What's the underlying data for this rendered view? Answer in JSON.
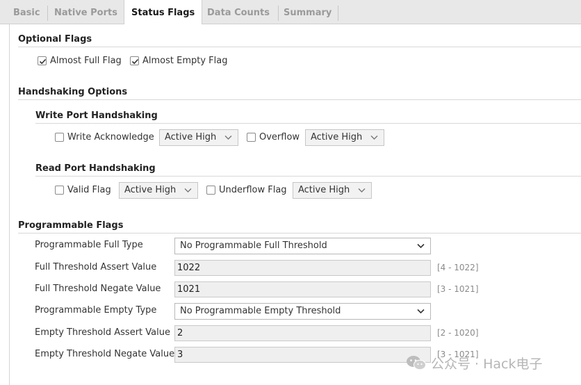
{
  "tabs": [
    {
      "label": "Basic",
      "active": false
    },
    {
      "label": "Native Ports",
      "active": false
    },
    {
      "label": "Status Flags",
      "active": true
    },
    {
      "label": "Data Counts",
      "active": false
    },
    {
      "label": "Summary",
      "active": false
    }
  ],
  "optional_flags": {
    "title": "Optional Flags",
    "almost_full": {
      "label": "Almost Full Flag",
      "checked": true
    },
    "almost_empty": {
      "label": "Almost Empty Flag",
      "checked": true
    }
  },
  "handshaking": {
    "title": "Handshaking Options",
    "write": {
      "title": "Write Port Handshaking",
      "ack_label": "Write Acknowledge",
      "ack_checked": false,
      "ack_select": "Active High",
      "overflow_label": "Overflow",
      "overflow_checked": false,
      "overflow_select": "Active High"
    },
    "read": {
      "title": "Read Port Handshaking",
      "valid_label": "Valid Flag",
      "valid_checked": false,
      "valid_select": "Active High",
      "underflow_label": "Underflow Flag",
      "underflow_checked": false,
      "underflow_select": "Active High"
    }
  },
  "programmable": {
    "title": "Programmable Flags",
    "full_type_label": "Programmable Full Type",
    "full_type_value": "No Programmable Full Threshold",
    "full_assert_label": "Full Threshold Assert Value",
    "full_assert_value": "1022",
    "full_assert_range": "[4 - 1022]",
    "full_negate_label": "Full Threshold Negate Value",
    "full_negate_value": "1021",
    "full_negate_range": "[3 - 1021]",
    "empty_type_label": "Programmable Empty Type",
    "empty_type_value": "No Programmable Empty Threshold",
    "empty_assert_label": "Empty Threshold Assert Value",
    "empty_assert_value": "2",
    "empty_assert_range": "[2 - 1020]",
    "empty_negate_label": "Empty Threshold Negate Value",
    "empty_negate_value": "3",
    "empty_negate_range": "[3 - 1021]"
  },
  "watermark": "公众号 · Hack电子"
}
